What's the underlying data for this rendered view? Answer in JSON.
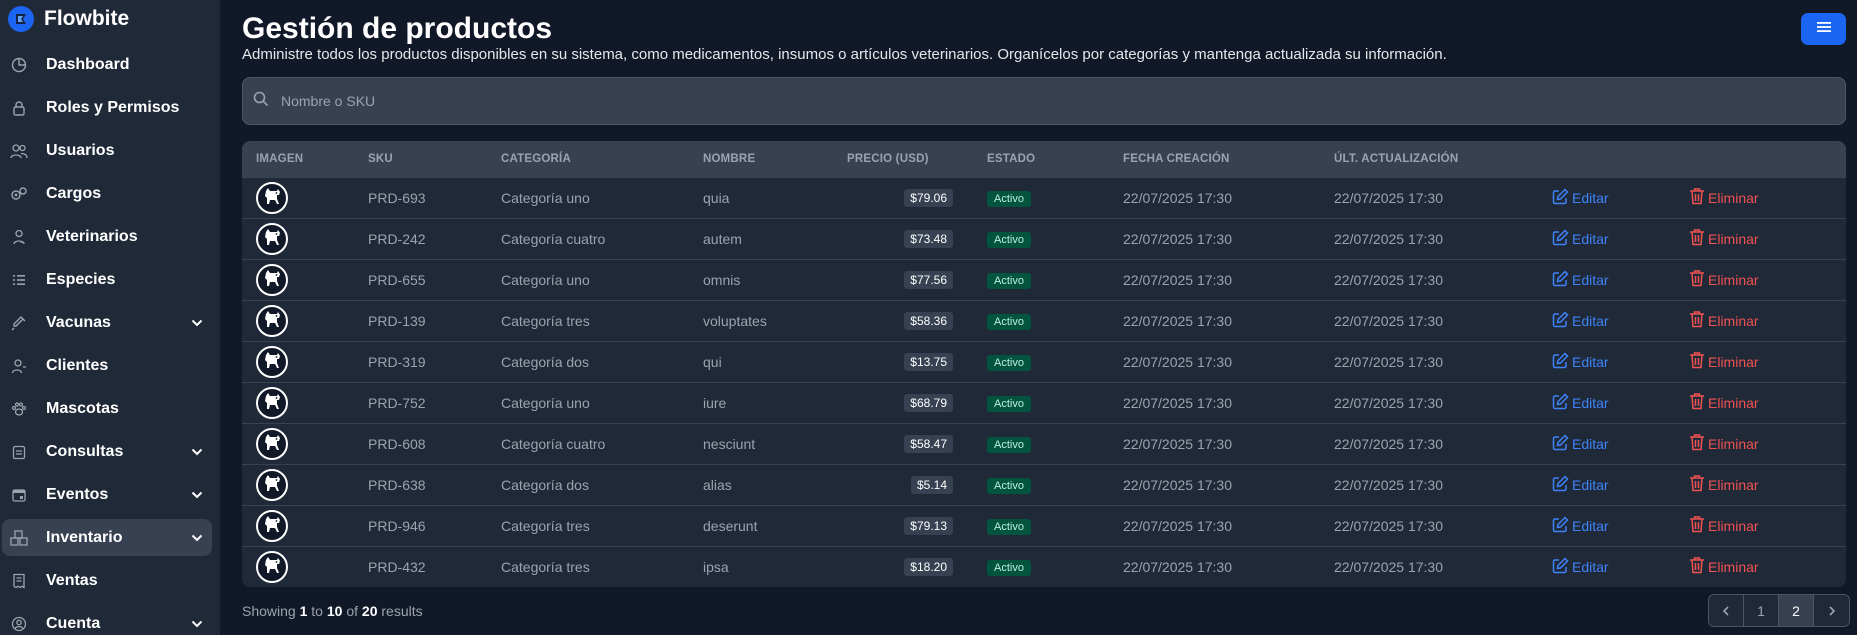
{
  "brand": {
    "name": "Flowbite",
    "accent": "#1c64f2"
  },
  "sidebar": {
    "items": [
      {
        "label": "Dashboard",
        "icon": "chart-pie-icon",
        "expandable": false,
        "active": false
      },
      {
        "label": "Roles y Permisos",
        "icon": "lock-icon",
        "expandable": false,
        "active": false
      },
      {
        "label": "Usuarios",
        "icon": "users-icon",
        "expandable": false,
        "active": false
      },
      {
        "label": "Cargos",
        "icon": "gears-icon",
        "expandable": false,
        "active": false
      },
      {
        "label": "Veterinarios",
        "icon": "doctor-icon",
        "expandable": false,
        "active": false
      },
      {
        "label": "Especies",
        "icon": "list-icon",
        "expandable": false,
        "active": false
      },
      {
        "label": "Vacunas",
        "icon": "syringe-icon",
        "expandable": true,
        "active": false
      },
      {
        "label": "Clientes",
        "icon": "user-icon",
        "expandable": false,
        "active": false
      },
      {
        "label": "Mascotas",
        "icon": "paw-icon",
        "expandable": false,
        "active": false
      },
      {
        "label": "Consultas",
        "icon": "clipboard-icon",
        "expandable": true,
        "active": false
      },
      {
        "label": "Eventos",
        "icon": "calendar-icon",
        "expandable": true,
        "active": false
      },
      {
        "label": "Inventario",
        "icon": "boxes-icon",
        "expandable": true,
        "active": true
      },
      {
        "label": "Ventas",
        "icon": "receipt-icon",
        "expandable": false,
        "active": false
      },
      {
        "label": "Cuenta",
        "icon": "user-circle-icon",
        "expandable": true,
        "active": false
      }
    ]
  },
  "header": {
    "title": "Gestión de productos",
    "subtitle": "Administre todos los productos disponibles en su sistema, como medicamentos, insumos o artículos veterinarios. Organícelos por categorías y mantenga actualizada su información.",
    "menu_icon": "hamburger-icon"
  },
  "search": {
    "placeholder": "Nombre o SKU",
    "value": ""
  },
  "table": {
    "columns": [
      "Imagen",
      "SKU",
      "Categoría",
      "Nombre",
      "Precio (USD)",
      "Estado",
      "Fecha creación",
      "Últ. actualización",
      "",
      ""
    ],
    "edit_label": "Editar",
    "delete_label": "Eliminar",
    "rows": [
      {
        "sku": "PRD-693",
        "category": "Categoría uno",
        "name": "quia",
        "price": "$79.06",
        "status": "Activo",
        "created": "22/07/2025 17:30",
        "updated": "22/07/2025 17:30"
      },
      {
        "sku": "PRD-242",
        "category": "Categoría cuatro",
        "name": "autem",
        "price": "$73.48",
        "status": "Activo",
        "created": "22/07/2025 17:30",
        "updated": "22/07/2025 17:30"
      },
      {
        "sku": "PRD-655",
        "category": "Categoría uno",
        "name": "omnis",
        "price": "$77.56",
        "status": "Activo",
        "created": "22/07/2025 17:30",
        "updated": "22/07/2025 17:30"
      },
      {
        "sku": "PRD-139",
        "category": "Categoría tres",
        "name": "voluptates",
        "price": "$58.36",
        "status": "Activo",
        "created": "22/07/2025 17:30",
        "updated": "22/07/2025 17:30"
      },
      {
        "sku": "PRD-319",
        "category": "Categoría dos",
        "name": "qui",
        "price": "$13.75",
        "status": "Activo",
        "created": "22/07/2025 17:30",
        "updated": "22/07/2025 17:30"
      },
      {
        "sku": "PRD-752",
        "category": "Categoría uno",
        "name": "iure",
        "price": "$68.79",
        "status": "Activo",
        "created": "22/07/2025 17:30",
        "updated": "22/07/2025 17:30"
      },
      {
        "sku": "PRD-608",
        "category": "Categoría cuatro",
        "name": "nesciunt",
        "price": "$58.47",
        "status": "Activo",
        "created": "22/07/2025 17:30",
        "updated": "22/07/2025 17:30"
      },
      {
        "sku": "PRD-638",
        "category": "Categoría dos",
        "name": "alias",
        "price": "$5.14",
        "status": "Activo",
        "created": "22/07/2025 17:30",
        "updated": "22/07/2025 17:30"
      },
      {
        "sku": "PRD-946",
        "category": "Categoría tres",
        "name": "deserunt",
        "price": "$79.13",
        "status": "Activo",
        "created": "22/07/2025 17:30",
        "updated": "22/07/2025 17:30"
      },
      {
        "sku": "PRD-432",
        "category": "Categoría tres",
        "name": "ipsa",
        "price": "$18.20",
        "status": "Activo",
        "created": "22/07/2025 17:30",
        "updated": "22/07/2025 17:30"
      }
    ]
  },
  "footer": {
    "showing_prefix": "Showing",
    "from": "1",
    "to_word": "to",
    "to": "10",
    "of_word": "of",
    "total": "20",
    "results_word": "results"
  },
  "pagination": {
    "pages": [
      "1",
      "2"
    ],
    "current": "2"
  },
  "colors": {
    "edit": "#3f83f8",
    "delete": "#f05252",
    "status_active_bg": "#03543f"
  }
}
